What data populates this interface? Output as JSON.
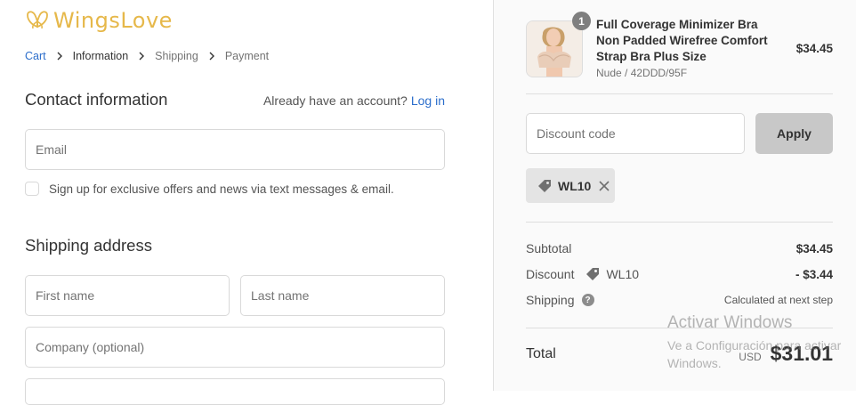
{
  "brand": {
    "name": "WingsLove"
  },
  "breadcrumb": [
    "Cart",
    "Information",
    "Shipping",
    "Payment"
  ],
  "contact": {
    "title": "Contact information",
    "account_prompt": "Already have an account?",
    "login_link": "Log in",
    "email_placeholder": "Email",
    "sms_optin": "Sign up for exclusive offers and news via text messages & email."
  },
  "shipping": {
    "title": "Shipping address",
    "first_name_placeholder": "First name",
    "last_name_placeholder": "Last name",
    "company_placeholder": "Company (optional)"
  },
  "order": {
    "item": {
      "quantity": "1",
      "name": "Full Coverage Minimizer Bra Non Padded Wirefree Comfort Strap Bra Plus Size",
      "variant": "Nude / 42DDD/95F",
      "price": "$34.45"
    },
    "discount_placeholder": "Discount code",
    "apply_label": "Apply",
    "applied_code": "WL10",
    "subtotal_label": "Subtotal",
    "subtotal_value": "$34.45",
    "discount_label": "Discount",
    "discount_code": "WL10",
    "discount_value": "- $3.44",
    "shipping_label": "Shipping",
    "shipping_value": "Calculated at next step",
    "total_label": "Total",
    "currency": "USD",
    "total_value": "$31.01"
  },
  "watermark": {
    "line1": "Activar Windows",
    "line2": "Ve a Configuración para activar Windows."
  },
  "colors": {
    "accent": "#2c6ecb",
    "brand_gold": "#e6b84a",
    "apply_bg": "#c8c8c8"
  },
  "icons": [
    "wings-logo-icon",
    "chevron-right-icon",
    "tag-icon",
    "close-icon",
    "question-icon"
  ]
}
